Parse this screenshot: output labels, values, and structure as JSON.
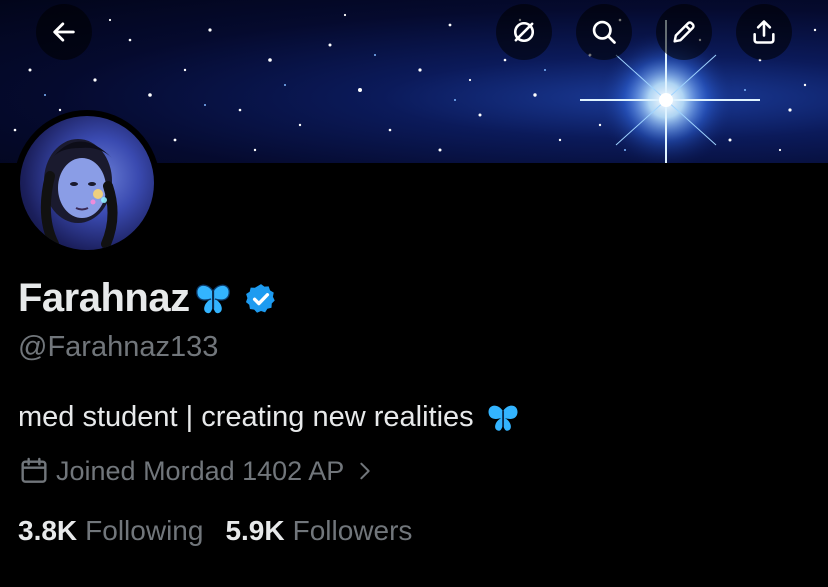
{
  "header": {
    "icons": {
      "back": "arrow-left-icon",
      "grok": "grok-icon",
      "search": "search-icon",
      "edit": "pencil-icon",
      "share": "share-icon"
    }
  },
  "profile": {
    "display_name": "Farahnaz",
    "handle": "@Farahnaz133",
    "bio": "med student | creating new realities",
    "joined": "Joined Mordad 1402 AP",
    "verified": true,
    "emoji": "butterfly",
    "colors": {
      "verified_blue": "#1d9bf0",
      "muted": "#71767b",
      "text": "#e7e9ea"
    }
  },
  "stats": {
    "following_count": "3.8K",
    "following_label": "Following",
    "followers_count": "5.9K",
    "followers_label": "Followers"
  }
}
